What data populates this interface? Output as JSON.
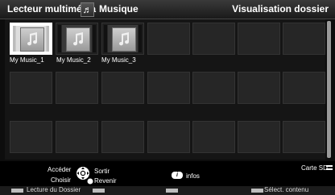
{
  "header": {
    "left_title": "Lecteur multimédia",
    "music_label": "Musique",
    "right_title": "Visualisation dossier",
    "note_icon": "♬"
  },
  "items": [
    {
      "label": "My Music_1"
    },
    {
      "label": "My Music_2"
    },
    {
      "label": "My Music_3"
    }
  ],
  "controls": {
    "acceder": "Accéder",
    "sortir": "Sortir",
    "choisir": "Choisir",
    "revenir": "Revenir",
    "info_icon_label": "i",
    "infos": "infos",
    "card": "Carte SD"
  },
  "footer": {
    "red_label": "Lecture du Dossier",
    "blue_label": "Sélect. contenu"
  }
}
